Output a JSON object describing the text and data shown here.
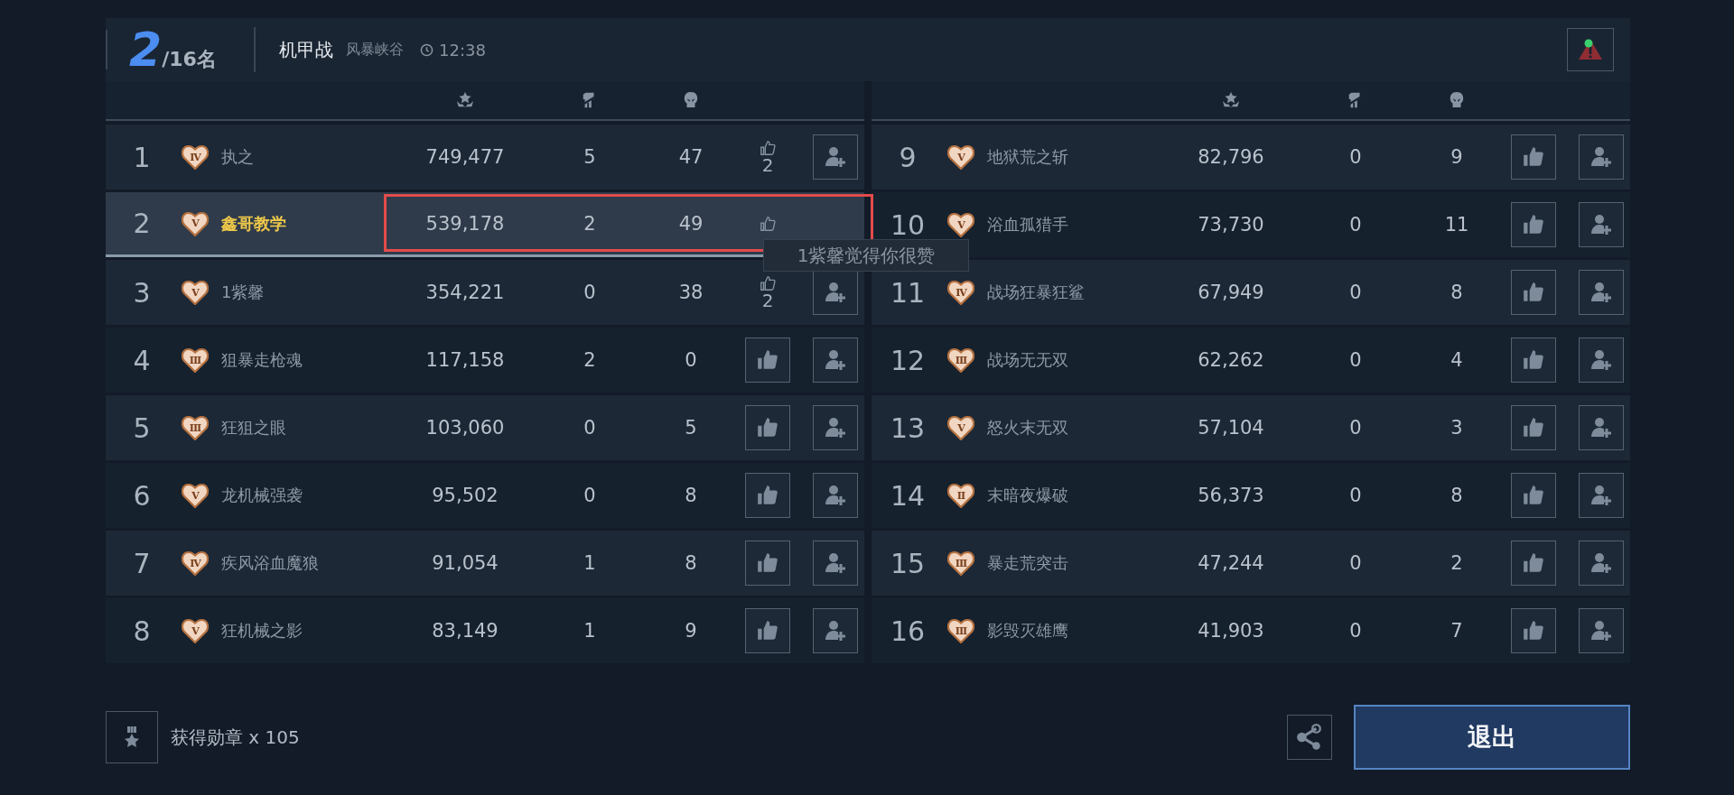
{
  "header": {
    "rank": "2",
    "total": "/16名",
    "mode": "机甲战",
    "map": "风暴峡谷",
    "time": "12:38",
    "alert": true
  },
  "columns": [
    {
      "kind": "score"
    },
    {
      "kind": "kills"
    },
    {
      "kind": "deaths"
    }
  ],
  "players_left": [
    {
      "rank": "1",
      "badge": "IV",
      "name": "执之",
      "score": "749,477",
      "kills": "5",
      "deaths": "47",
      "kind": "received",
      "likes": "2",
      "add_friend": true,
      "selected": false,
      "marked": false
    },
    {
      "rank": "2",
      "badge": "V",
      "name": "鑫哥教学",
      "score": "539,178",
      "kills": "2",
      "deaths": "49",
      "kind": "received",
      "add_friend": false,
      "selected": true,
      "marked": true,
      "tooltip": "1紫馨觉得你很赞"
    },
    {
      "rank": "3",
      "badge": "V",
      "name": "1紫馨",
      "score": "354,221",
      "kills": "0",
      "deaths": "38",
      "kind": "received",
      "likes": "2",
      "add_friend": true,
      "selected": false,
      "marked": false
    },
    {
      "rank": "4",
      "badge": "III",
      "name": "狙暴走枪魂",
      "score": "117,158",
      "kills": "2",
      "deaths": "0",
      "kind": "button",
      "add_friend": true,
      "selected": false,
      "marked": false
    },
    {
      "rank": "5",
      "badge": "III",
      "name": "狂狙之眼",
      "score": "103,060",
      "kills": "0",
      "deaths": "5",
      "kind": "button",
      "add_friend": true,
      "selected": false,
      "marked": false
    },
    {
      "rank": "6",
      "badge": "V",
      "name": "龙机械强袭",
      "score": "95,502",
      "kills": "0",
      "deaths": "8",
      "kind": "button",
      "add_friend": true,
      "selected": false,
      "marked": false
    },
    {
      "rank": "7",
      "badge": "IV",
      "name": "疾风浴血魔狼",
      "score": "91,054",
      "kills": "1",
      "deaths": "8",
      "kind": "button",
      "add_friend": true,
      "selected": false,
      "marked": false
    },
    {
      "rank": "8",
      "badge": "V",
      "name": "狂机械之影",
      "score": "83,149",
      "kills": "1",
      "deaths": "9",
      "kind": "button",
      "add_friend": true,
      "selected": false,
      "marked": false
    }
  ],
  "players_right": [
    {
      "rank": "9",
      "badge": "V",
      "name": "地狱荒之斩",
      "score": "82,796",
      "kills": "0",
      "deaths": "9",
      "kind": "button",
      "add_friend": true,
      "selected": false,
      "marked": false
    },
    {
      "rank": "10",
      "badge": "V",
      "name": "浴血孤猎手",
      "score": "73,730",
      "kills": "0",
      "deaths": "11",
      "kind": "button",
      "add_friend": true,
      "selected": false,
      "marked": false
    },
    {
      "rank": "11",
      "badge": "IV",
      "name": "战场狂暴狂鲨",
      "score": "67,949",
      "kills": "0",
      "deaths": "8",
      "kind": "button",
      "add_friend": true,
      "selected": false,
      "marked": false
    },
    {
      "rank": "12",
      "badge": "III",
      "name": "战场无无双",
      "score": "62,262",
      "kills": "0",
      "deaths": "4",
      "kind": "button",
      "add_friend": true,
      "selected": false,
      "marked": false
    },
    {
      "rank": "13",
      "badge": "V",
      "name": "怒火末无双",
      "score": "57,104",
      "kills": "0",
      "deaths": "3",
      "kind": "button",
      "add_friend": true,
      "selected": false,
      "marked": false
    },
    {
      "rank": "14",
      "badge": "II",
      "name": "末暗夜爆破",
      "score": "56,373",
      "kills": "0",
      "deaths": "8",
      "kind": "button",
      "add_friend": true,
      "selected": false,
      "marked": false
    },
    {
      "rank": "15",
      "badge": "III",
      "name": "暴走荒突击",
      "score": "47,244",
      "kills": "0",
      "deaths": "2",
      "kind": "button",
      "add_friend": true,
      "selected": false,
      "marked": false
    },
    {
      "rank": "16",
      "badge": "III",
      "name": "影毁灭雄鹰",
      "score": "41,903",
      "kills": "0",
      "deaths": "7",
      "kind": "button",
      "add_friend": true,
      "selected": false,
      "marked": false
    }
  ],
  "medals": "获得勋章 x 105",
  "exit_button": "退出"
}
